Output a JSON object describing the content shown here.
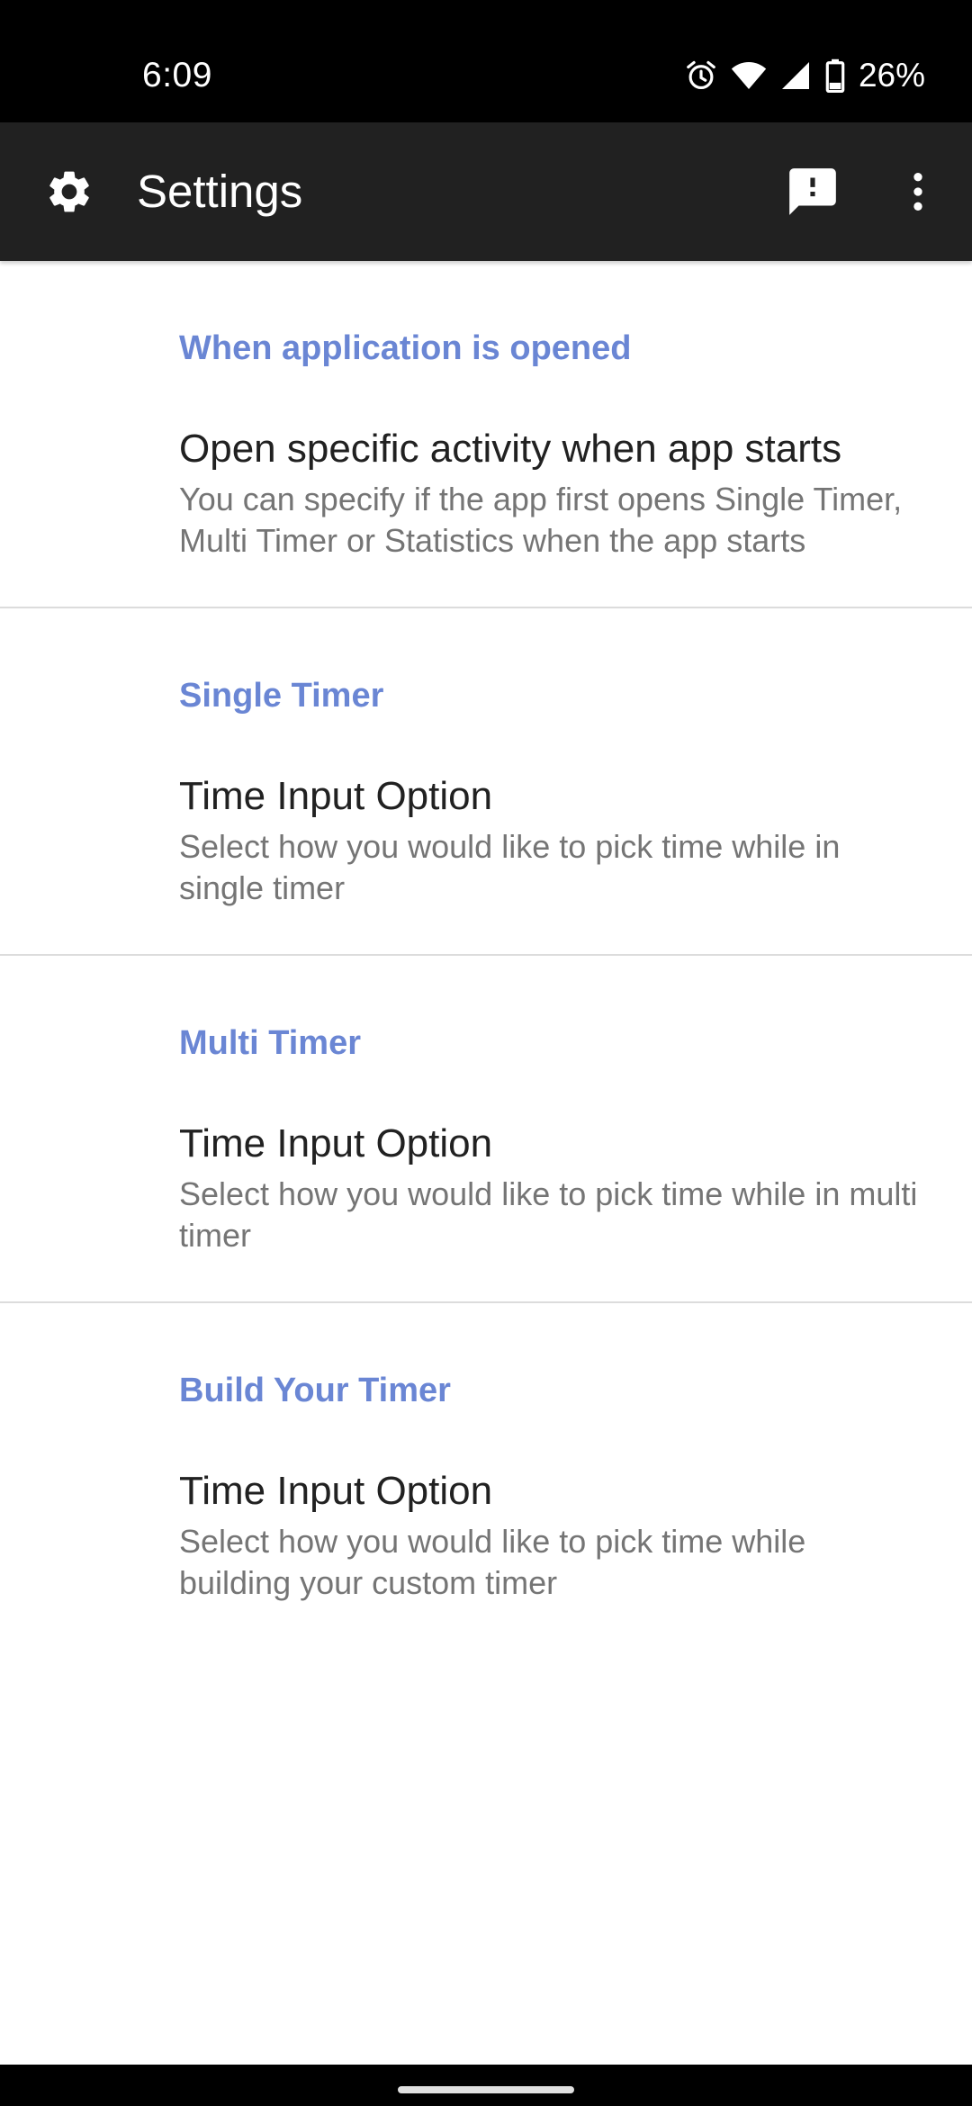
{
  "status_bar": {
    "time": "6:09",
    "battery_percent": "26%",
    "icons": [
      "alarm-icon",
      "wifi-icon",
      "signal-icon",
      "battery-icon"
    ]
  },
  "toolbar": {
    "title": "Settings",
    "icons": [
      "gear-icon",
      "feedback-icon",
      "more-vert-icon"
    ],
    "background": "#212121"
  },
  "sections": [
    {
      "header": "When application is opened",
      "title": "Open specific activity when app starts",
      "summary": "You can specify if the app first opens Single Timer, Multi Timer or Statistics when the app starts"
    },
    {
      "header": "Single Timer",
      "title": "Time Input Option",
      "summary": "Select how you would like to pick time while in single timer"
    },
    {
      "header": "Multi Timer",
      "title": "Time Input Option",
      "summary": "Select how you would like to pick time while in multi timer"
    },
    {
      "header": "Build Your Timer",
      "title": "Time Input Option",
      "summary": "Select how you would like to pick time while building your custom timer"
    }
  ],
  "colors": {
    "accent": "#6a86d4",
    "title_text": "#212121",
    "summary_text": "#757575",
    "divider": "#dcdcdc"
  }
}
